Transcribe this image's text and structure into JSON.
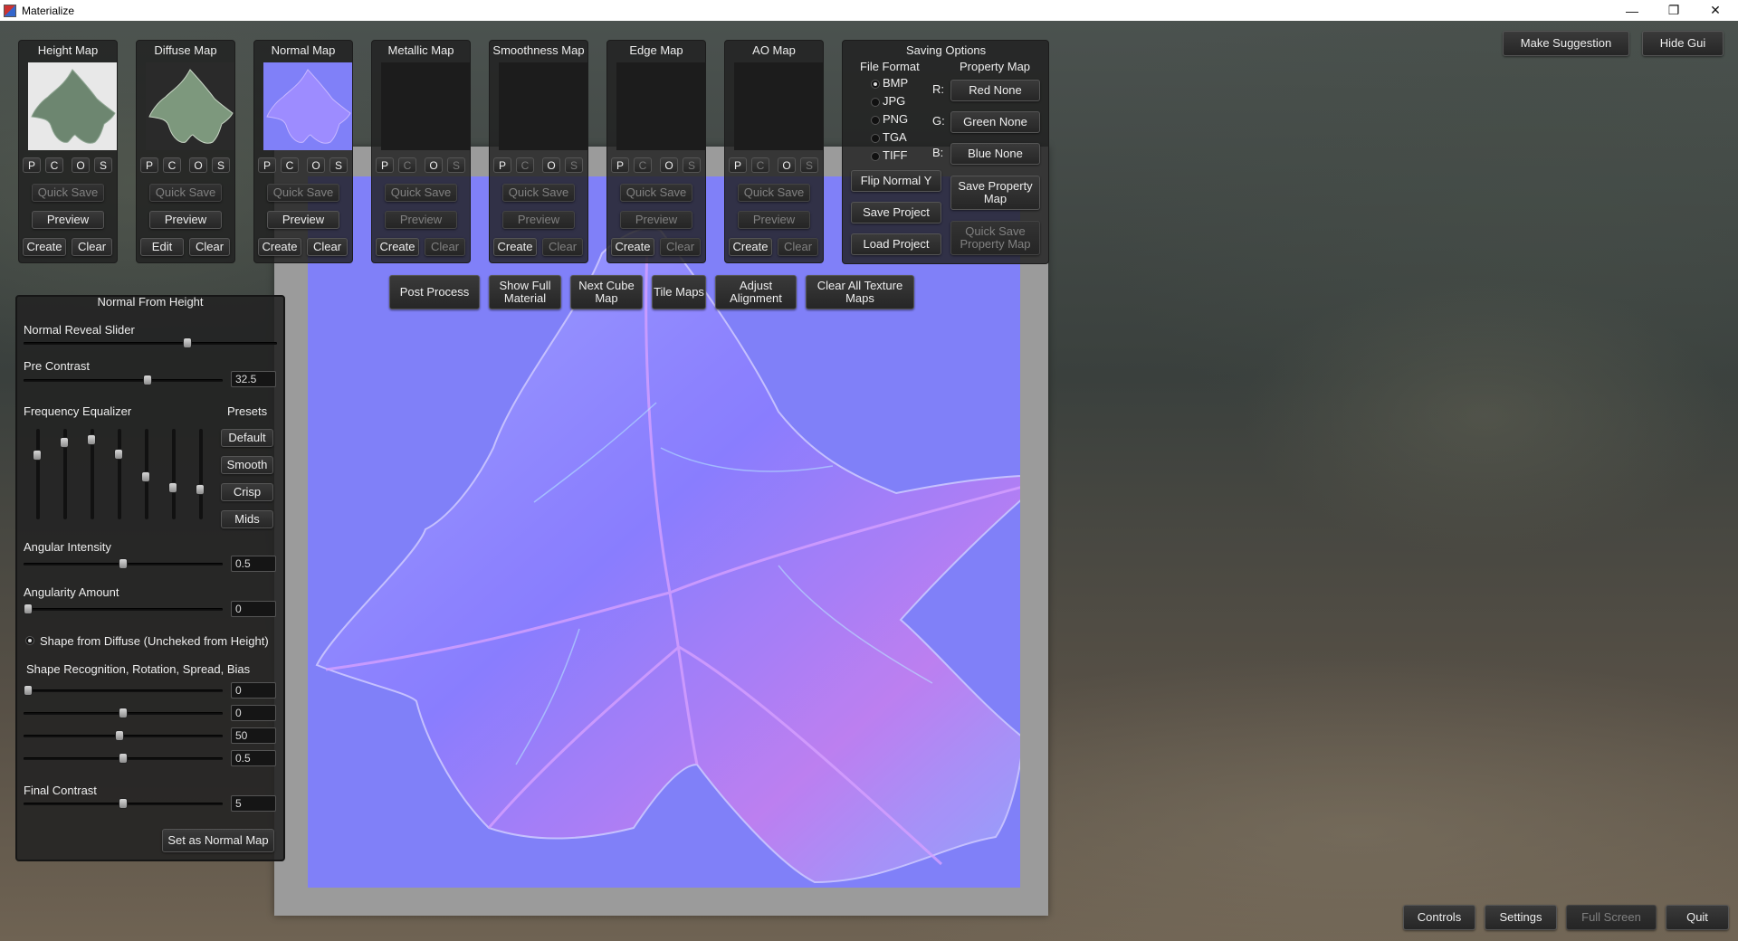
{
  "window": {
    "title": "Materialize",
    "minimize": "—",
    "maximize": "❐",
    "close": "✕"
  },
  "map_panels": [
    {
      "title": "Height Map",
      "quick_save": "Quick Save",
      "preview": "Preview",
      "left": "Create",
      "right": "Clear"
    },
    {
      "title": "Diffuse Map",
      "quick_save": "Quick Save",
      "preview": "Preview",
      "left": "Edit",
      "right": "Clear"
    },
    {
      "title": "Normal Map",
      "quick_save": "Quick Save",
      "preview": "Preview",
      "left": "Create",
      "right": "Clear"
    },
    {
      "title": "Metallic Map",
      "quick_save": "Quick Save",
      "preview": "Preview",
      "left": "Create",
      "right": "Clear"
    },
    {
      "title": "Smoothness Map",
      "quick_save": "Quick Save",
      "preview": "Preview",
      "left": "Create",
      "right": "Clear"
    },
    {
      "title": "Edge Map",
      "quick_save": "Quick Save",
      "preview": "Preview",
      "left": "Create",
      "right": "Clear"
    },
    {
      "title": "AO Map",
      "quick_save": "Quick Save",
      "preview": "Preview",
      "left": "Create",
      "right": "Clear"
    }
  ],
  "pcos": [
    "P",
    "C",
    "O",
    "S"
  ],
  "saving": {
    "title": "Saving Options",
    "file_format": "File Format",
    "property_map": "Property Map",
    "formats": [
      "BMP",
      "JPG",
      "PNG",
      "TGA",
      "TIFF"
    ],
    "selected_format": "BMP",
    "channels": [
      {
        "label": "R:",
        "value": "Red None"
      },
      {
        "label": "G:",
        "value": "Green None"
      },
      {
        "label": "B:",
        "value": "Blue None"
      }
    ],
    "flip_normal": "Flip Normal Y",
    "save_project": "Save Project",
    "load_project": "Load Project",
    "save_property": "Save Property Map",
    "quick_save_property": "Quick Save Property Map"
  },
  "toolbar": {
    "post_process": "Post Process",
    "show_full": "Show Full Material",
    "next_cube": "Next Cube Map",
    "tile_maps": "Tile Maps",
    "adjust": "Adjust Alignment",
    "clear_all": "Clear All Texture Maps"
  },
  "top_right": {
    "suggest": "Make Suggestion",
    "hide": "Hide Gui"
  },
  "bottom": {
    "controls": "Controls",
    "settings": "Settings",
    "fullscreen": "Full Screen",
    "quit": "Quit"
  },
  "nfh": {
    "title": "Normal From Height",
    "reveal": "Normal Reveal Slider",
    "reveal_value": 0.65,
    "pre_contrast": "Pre Contrast",
    "pre_contrast_value": "32.5",
    "pre_contrast_pos": 0.63,
    "freq_eq": "Frequency Equalizer",
    "presets": "Presets",
    "eq_levels": [
      0.75,
      0.9,
      0.93,
      0.76,
      0.48,
      0.35,
      0.32
    ],
    "preset_buttons": [
      "Default",
      "Smooth",
      "Crisp",
      "Mids"
    ],
    "angular_intensity": "Angular Intensity",
    "angular_intensity_value": "0.5",
    "angular_intensity_pos": 0.5,
    "angularity_amount": "Angularity Amount",
    "angularity_amount_value": "0",
    "angularity_amount_pos": 0.0,
    "shape_from_diffuse": "Shape from Diffuse (Uncheked from Height)",
    "shape_recog": "Shape Recognition, Rotation, Spread, Bias",
    "shape_values": [
      "0",
      "0",
      "50",
      "0.5"
    ],
    "shape_pos": [
      0.0,
      0.5,
      0.48,
      0.5
    ],
    "final_contrast": "Final Contrast",
    "final_contrast_value": "5",
    "final_contrast_pos": 0.5,
    "set_normal": "Set as Normal Map"
  }
}
